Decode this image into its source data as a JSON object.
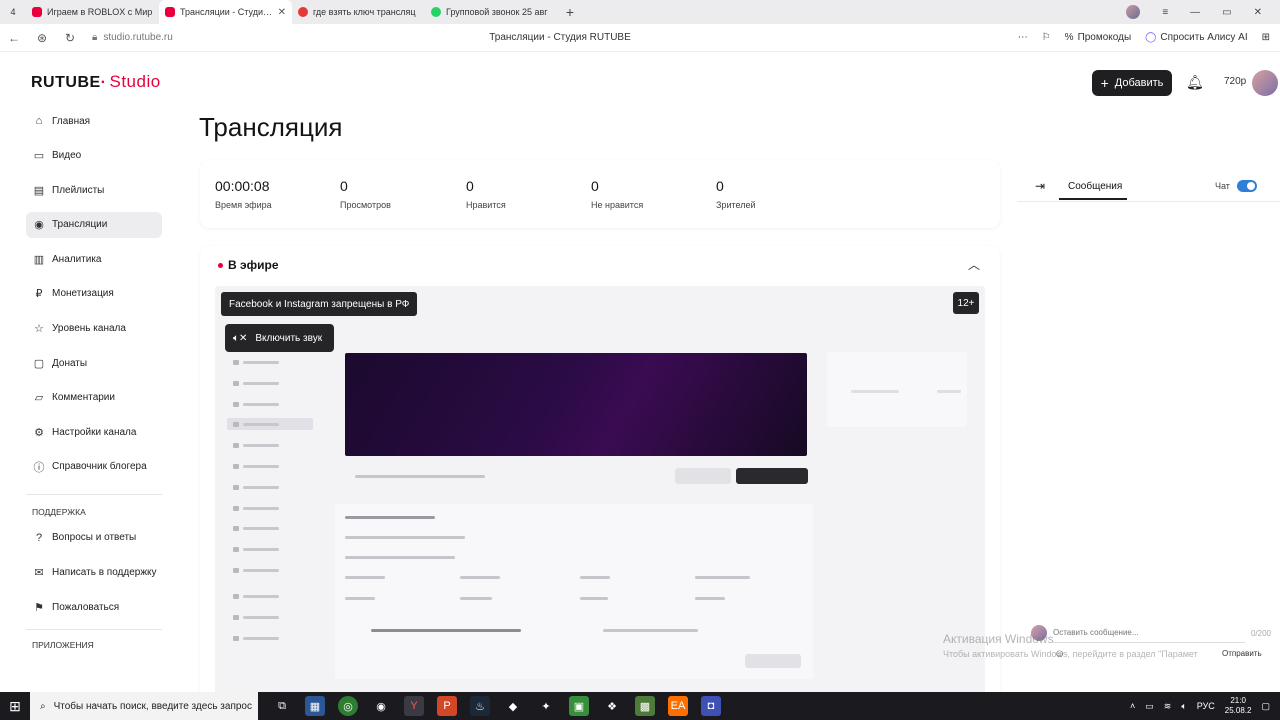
{
  "browser": {
    "tab_count": "4",
    "tabs": [
      {
        "title": "Играем в ROBLOX с Мир",
        "color": "#e8003d",
        "active": false
      },
      {
        "title": "Трансляции - Студия R",
        "color": "#e8003d",
        "active": true
      },
      {
        "title": "где взять ключ трансляц",
        "color": "#e53935",
        "active": false
      },
      {
        "title": "Групповой звонок 25 авг",
        "color": "#25d366",
        "active": false
      }
    ],
    "url": "studio.rutube.ru",
    "page_title": "Трансляции - Студия RUTUBE",
    "promo_label": "Промокоды",
    "alice_label": "Спросить Алису AI"
  },
  "app": {
    "logo_main": "RUTUBE",
    "logo_studio": "Studio",
    "add_button": "Добавить",
    "resolution": "720p"
  },
  "sidebar": {
    "items": [
      {
        "label": "Главная",
        "icon": "home-icon",
        "glyph": "⌂"
      },
      {
        "label": "Видео",
        "icon": "video-icon",
        "glyph": "▭"
      },
      {
        "label": "Плейлисты",
        "icon": "playlist-icon",
        "glyph": "▤"
      },
      {
        "label": "Трансляции",
        "icon": "broadcast-icon",
        "glyph": "◉"
      },
      {
        "label": "Аналитика",
        "icon": "analytics-icon",
        "glyph": "▥"
      },
      {
        "label": "Монетизация",
        "icon": "money-icon",
        "glyph": "₽"
      },
      {
        "label": "Уровень канала",
        "icon": "star-icon",
        "glyph": "☆"
      },
      {
        "label": "Донаты",
        "icon": "donate-icon",
        "glyph": "▢"
      },
      {
        "label": "Комментарии",
        "icon": "comment-icon",
        "glyph": "▱"
      },
      {
        "label": "Настройки канала",
        "icon": "gear-icon",
        "glyph": "⚙"
      },
      {
        "label": "Справочник блогера",
        "icon": "info-icon",
        "glyph": "ⓘ"
      }
    ],
    "support_section": "ПОДДЕРЖКА",
    "support_items": [
      {
        "label": "Вопросы и ответы",
        "icon": "question-icon",
        "glyph": "?"
      },
      {
        "label": "Написать в поддержку",
        "icon": "mail-icon",
        "glyph": "✉"
      },
      {
        "label": "Пожаловаться",
        "icon": "flag-icon",
        "glyph": "⚑"
      }
    ],
    "apps_section": "ПРИЛОЖЕНИЯ"
  },
  "main": {
    "title": "Трансляция",
    "stats": [
      {
        "value": "00:00:08",
        "label": "Время эфира"
      },
      {
        "value": "0",
        "label": "Просмотров"
      },
      {
        "value": "0",
        "label": "Нравится"
      },
      {
        "value": "0",
        "label": "Не нравится"
      },
      {
        "value": "0",
        "label": "Зрителей"
      }
    ],
    "live_label": "В эфире",
    "player": {
      "banner": "Facebook и Instagram запрещены в РФ",
      "age": "12+",
      "sound_button": "Включить звук"
    }
  },
  "chat": {
    "tab_label": "Сообщения",
    "toggle_label": "Чат",
    "toggle_on": true,
    "input_placeholder": "Оставить сообщение...",
    "counter": "0/200",
    "send_label": "Отправить"
  },
  "watermark": {
    "line1": "Активация Windows",
    "line2": "Чтобы активировать Windows, перейдите в раздел \"Парамет"
  },
  "taskbar": {
    "search_placeholder": "Чтобы начать поиск, введите здесь запрос",
    "lang": "РУС",
    "time": "21:0",
    "date": "25.08.2"
  },
  "colors": {
    "brand": "#e8003d",
    "toggle": "#2f7fd8",
    "dark_button": "#1f1f22"
  }
}
